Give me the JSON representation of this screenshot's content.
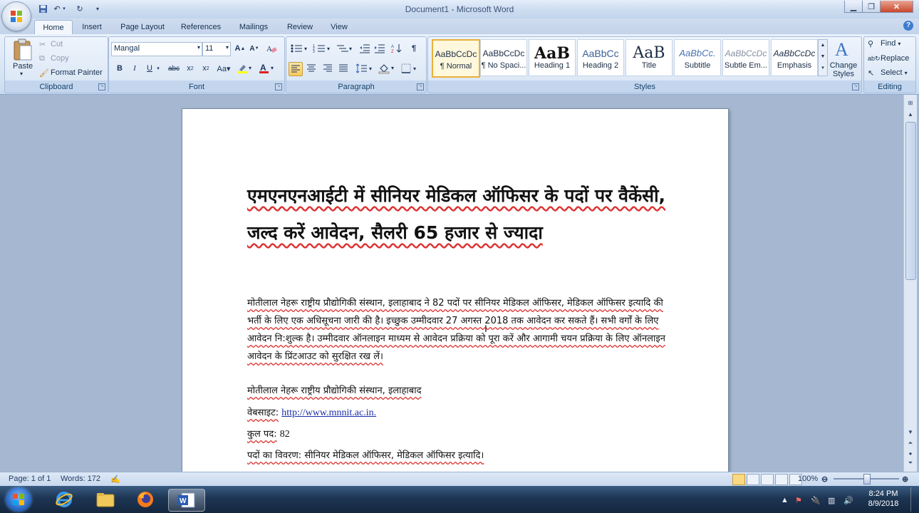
{
  "window": {
    "title": "Document1 - Microsoft Word"
  },
  "tabs": [
    "Home",
    "Insert",
    "Page Layout",
    "References",
    "Mailings",
    "Review",
    "View"
  ],
  "clipboard": {
    "paste": "Paste",
    "cut": "Cut",
    "copy": "Copy",
    "format_painter": "Format Painter",
    "label": "Clipboard"
  },
  "font": {
    "name": "Mangal",
    "size": "11",
    "label": "Font"
  },
  "paragraph": {
    "label": "Paragraph"
  },
  "styles": {
    "label": "Styles",
    "items": [
      {
        "sample": "AaBbCcDc",
        "name": "¶ Normal"
      },
      {
        "sample": "AaBbCcDc",
        "name": "¶ No Spaci..."
      },
      {
        "sample": "AaB",
        "name": "Heading 1"
      },
      {
        "sample": "AaBbCc",
        "name": "Heading 2"
      },
      {
        "sample": "AaB",
        "name": "Title"
      },
      {
        "sample": "AaBbCc.",
        "name": "Subtitle"
      },
      {
        "sample": "AaBbCcDc",
        "name": "Subtle Em..."
      },
      {
        "sample": "AaBbCcDc",
        "name": "Emphasis"
      }
    ],
    "change_styles": "Change Styles"
  },
  "editing": {
    "find": "Find",
    "replace": "Replace",
    "select": "Select",
    "label": "Editing"
  },
  "document": {
    "title": "एमएनएनआईटी में सीनियर मेडिकल ऑफिसर के पदों पर वैकेंसी, जल्द करें आवेदन, सैलरी 65 हजार से ज्यादा",
    "body": "मोतीलाल नेहरू राष्ट्रीय प्रौद्योगिकी संस्थान, इलाहाबाद ने 82 पदों पर सीनियर मेडिकल ऑफिसर, मेडिकल ऑफिसर इत्यादि की भर्ती के लिए एक अधिसूचना जारी की है। इच्छुक उम्मीदवार 27 अगस्त 2018 तक आवेदन कर सकते हैं। सभी वर्गों के लिए आवेदन नि:शुल्क है। उम्मीदवार ऑनलाइन माध्यम से आवेदन प्रक्रिया को पूरा करें और आगामी चयन प्रक्रिया के लिए ऑनलाइन आवेदन के प्रिंटआउट को सुरक्षित रख लें।",
    "institute": "मोतीलाल नेहरू राष्ट्रीय प्रौद्योगिकी संस्थान, इलाहाबाद",
    "website_label": "वेबसाइट:",
    "website_url": "http://www.mnnit.ac.in.",
    "posts_label": "कुल पद:",
    "posts_value": "82",
    "details": "पदों का विवरण: सीनियर मेडिकल ऑफिसर, मेडिकल ऑफिसर इत्यादि।"
  },
  "status": {
    "page": "Page: 1 of 1",
    "words": "Words: 172",
    "zoom": "100%"
  },
  "taskbar": {
    "time": "8:24 PM",
    "date": "8/9/2018"
  }
}
